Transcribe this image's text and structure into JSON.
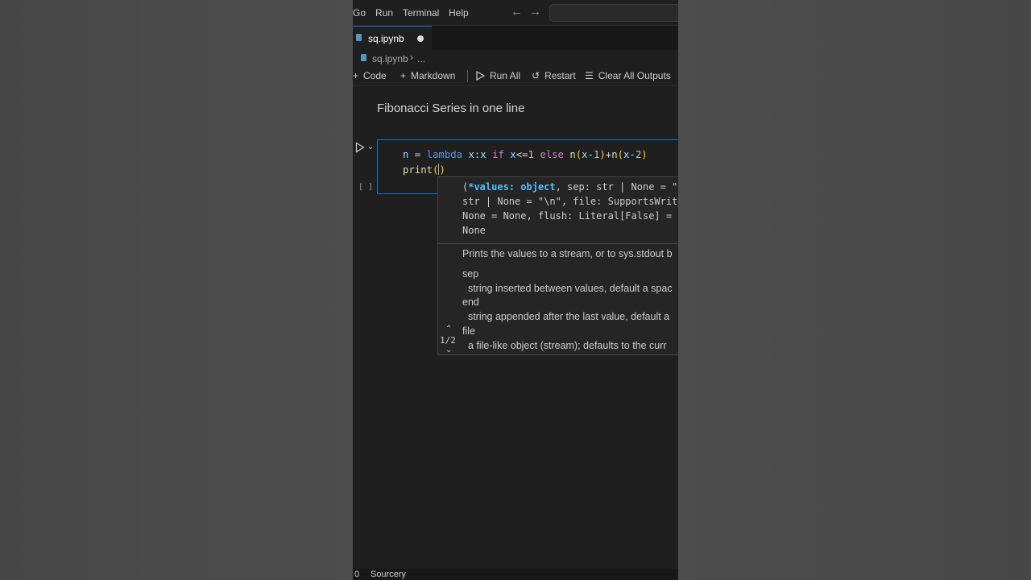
{
  "menubar": {
    "items": [
      "Go",
      "Run",
      "Terminal",
      "Help"
    ],
    "back_icon": "arrow-left-icon",
    "forward_icon": "arrow-right-icon"
  },
  "tab": {
    "label": "sq.ipynb",
    "state": "unsaved"
  },
  "breadcrumb": {
    "file": "sq.ipynb",
    "separator": "›",
    "more": "..."
  },
  "toolbar": {
    "code_label": "Code",
    "markdown_label": "Markdown",
    "run_all_label": "Run All",
    "restart_label": "Restart",
    "clear_outputs_label": "Clear All Outputs"
  },
  "notebook": {
    "markdown_heading": "Fibonacci Series in one line",
    "execution_count": "[ ]",
    "code": {
      "line1": {
        "t1": "n",
        "t2": " = ",
        "t3": "lambda",
        "t4": " x",
        "t5": ":",
        "t6": "x",
        "t7": " ",
        "t8": "if",
        "t9": " x",
        "t10": "<=",
        "t11": "1",
        "t12": " ",
        "t13": "else",
        "t14": " ",
        "t15": "n",
        "t16": "(",
        "t17": "x",
        "t18": "-",
        "t19": "1",
        "t20": ")",
        "t21": "+",
        "t22": "n",
        "t23": "(",
        "t24": "x",
        "t25": "-",
        "t26": "2",
        "t27": ")"
      },
      "line2": {
        "t1": "print",
        "t2": "(",
        "t3": ")"
      }
    }
  },
  "signature_help": {
    "sig": {
      "open": "(",
      "param": "*values: object",
      "rest1": ", sep: str | None = \"",
      "line2": "str | None = \"\\n\", file: SupportsWrit",
      "line3": "None = None, flush: Literal[False] = ",
      "line4": "None"
    },
    "doc": {
      "summary": "Prints the values to a stream, or to sys.stdout b",
      "sep": "sep",
      "sep_desc": "  string inserted between values, default a spac",
      "end": "end",
      "end_desc": "  string appended after the last value, default a",
      "file": "file",
      "file_desc": "  a file-like object (stream); defaults to the curr"
    },
    "overload_position": "1/2"
  },
  "statusbar": {
    "left_value": "0",
    "extension": "Sourcery"
  },
  "colors": {
    "accent": "#0078d4",
    "keyword": "#569cd6",
    "control": "#c586c0",
    "variable": "#9cdcfe",
    "function": "#dcdcaa",
    "number": "#b5cea8",
    "bracket": "#ffd700"
  }
}
